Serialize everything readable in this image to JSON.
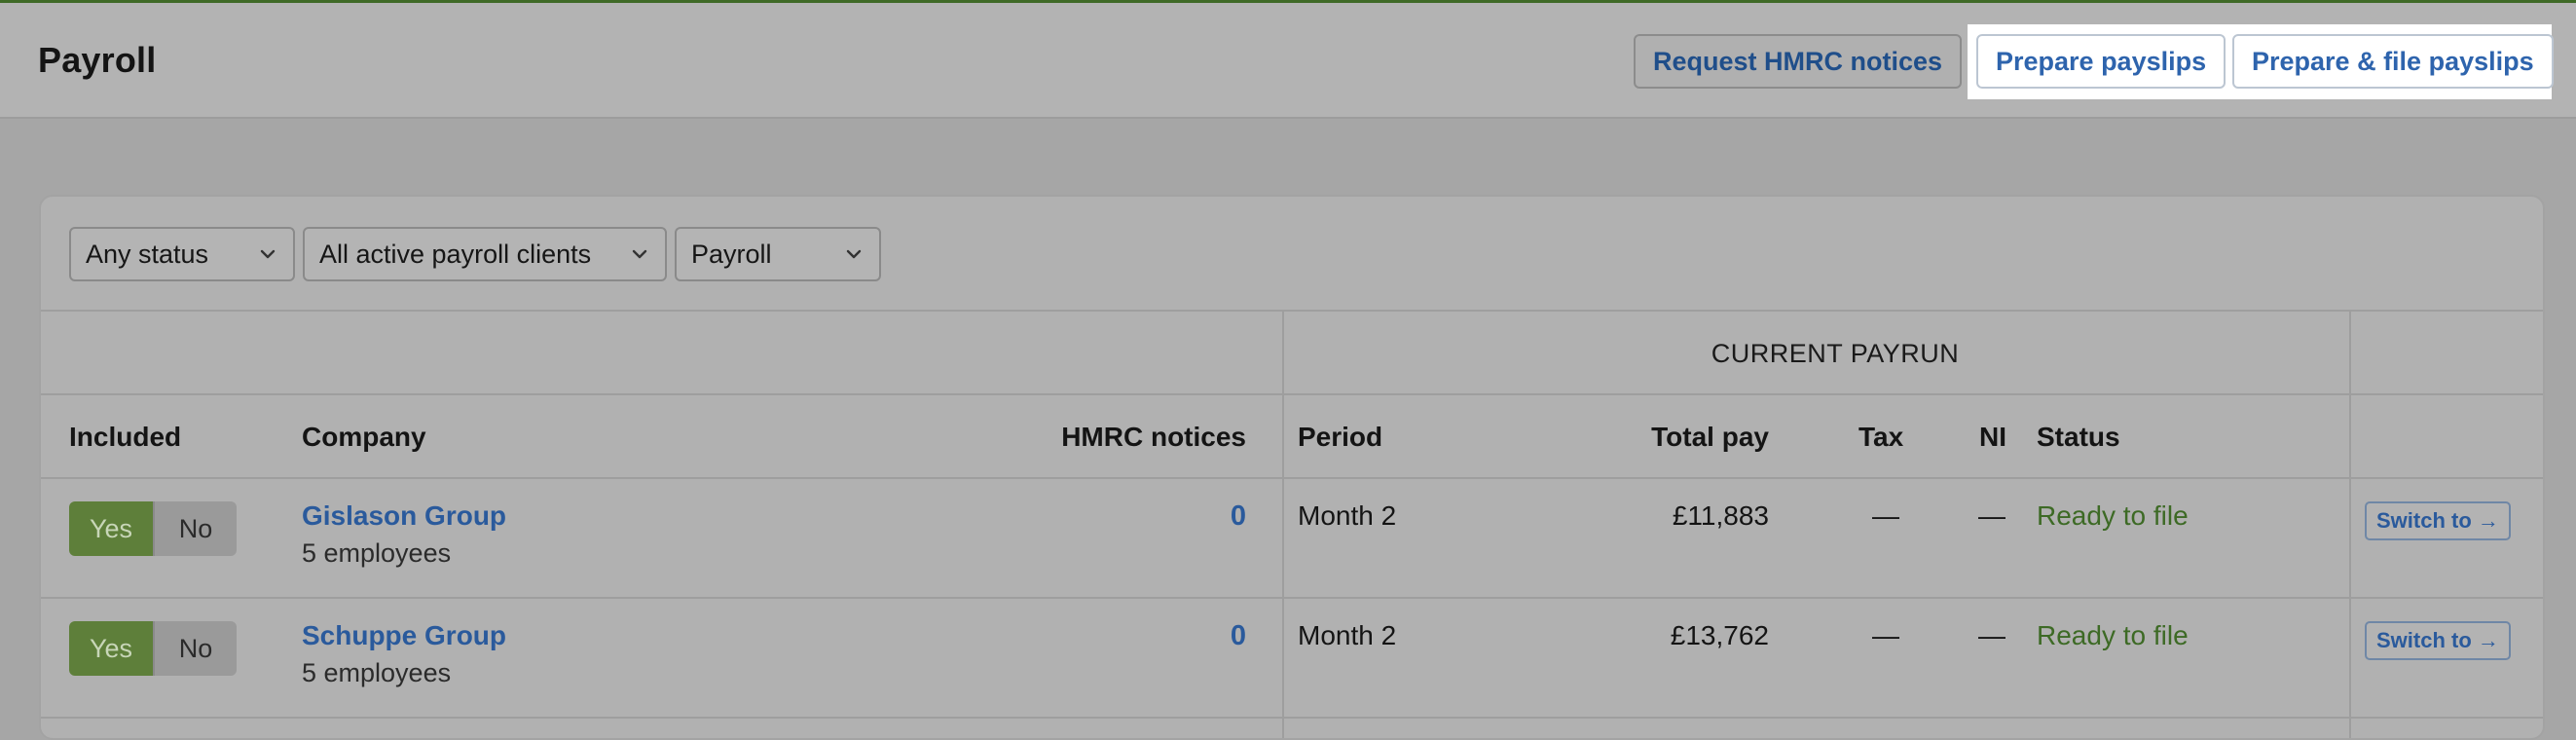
{
  "header": {
    "title": "Payroll",
    "buttons": {
      "request_hmrc": "Request HMRC notices",
      "prepare_payslips": "Prepare payslips",
      "prepare_file_payslips": "Prepare & file payslips"
    }
  },
  "filters": {
    "status": "Any status",
    "clients": "All active payroll clients",
    "type": "Payroll"
  },
  "table": {
    "group_header": "CURRENT PAYRUN",
    "columns": {
      "included": "Included",
      "company": "Company",
      "hmrc_notices": "HMRC notices",
      "period": "Period",
      "total_pay": "Total pay",
      "tax": "Tax",
      "ni": "NI",
      "status": "Status"
    },
    "rows": [
      {
        "yes": "Yes",
        "no": "No",
        "company": "Gislason Group",
        "employees": "5 employees",
        "notices": "0",
        "period": "Month 2",
        "total_pay": "£11,883",
        "tax": "—",
        "ni": "—",
        "status": "Ready to file",
        "action": "Switch to →"
      },
      {
        "yes": "Yes",
        "no": "No",
        "company": "Schuppe Group",
        "employees": "5 employees",
        "notices": "0",
        "period": "Month 2",
        "total_pay": "£13,762",
        "tax": "—",
        "ni": "—",
        "status": "Ready to file",
        "action": "Switch to →"
      }
    ]
  },
  "colors": {
    "accent_green": "#3f6a27",
    "link_blue": "#2a5a9c",
    "status_green": "#3d6a25"
  }
}
